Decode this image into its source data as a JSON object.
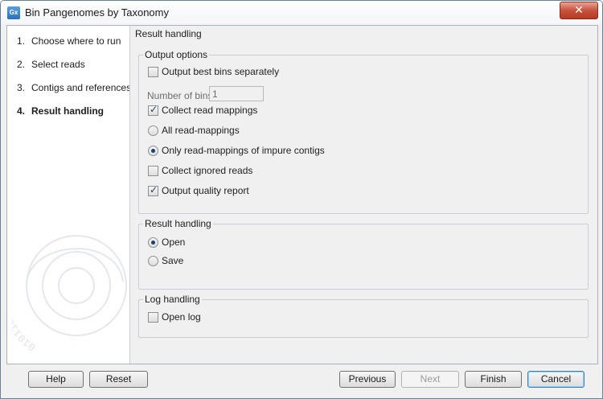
{
  "window": {
    "app_icon_text": "Gx",
    "title": "Bin Pangenomes by Taxonomy",
    "close_glyph": "✕"
  },
  "steps": [
    {
      "num": "1.",
      "label": "Choose where to run",
      "active": false
    },
    {
      "num": "2.",
      "label": "Select reads",
      "active": false
    },
    {
      "num": "3.",
      "label": "Contigs and references",
      "active": false
    },
    {
      "num": "4.",
      "label": "Result handling",
      "active": true
    }
  ],
  "section_title": "Result handling",
  "output_options": {
    "legend": "Output options",
    "output_best_bins": {
      "label": "Output best bins separately",
      "checked": false
    },
    "number_of_bins": {
      "label": "Number of bins",
      "value": "1"
    },
    "collect_read_mappings": {
      "label": "Collect read mappings",
      "checked": true
    },
    "all_read_mappings": {
      "label": "All read-mappings",
      "selected": false
    },
    "only_impure": {
      "label": "Only read-mappings of impure contigs",
      "selected": true
    },
    "collect_ignored_reads": {
      "label": "Collect ignored reads",
      "checked": false
    },
    "output_quality_report": {
      "label": "Output quality report",
      "checked": true
    }
  },
  "result_handling": {
    "legend": "Result handling",
    "open": {
      "label": "Open",
      "selected": true
    },
    "save": {
      "label": "Save",
      "selected": false
    }
  },
  "log_handling": {
    "legend": "Log handling",
    "open_log": {
      "label": "Open log",
      "checked": false
    }
  },
  "buttons": {
    "help": "Help",
    "reset": "Reset",
    "previous": "Previous",
    "next": "Next",
    "finish": "Finish",
    "cancel": "Cancel"
  },
  "watermark_text": "0101100101010"
}
